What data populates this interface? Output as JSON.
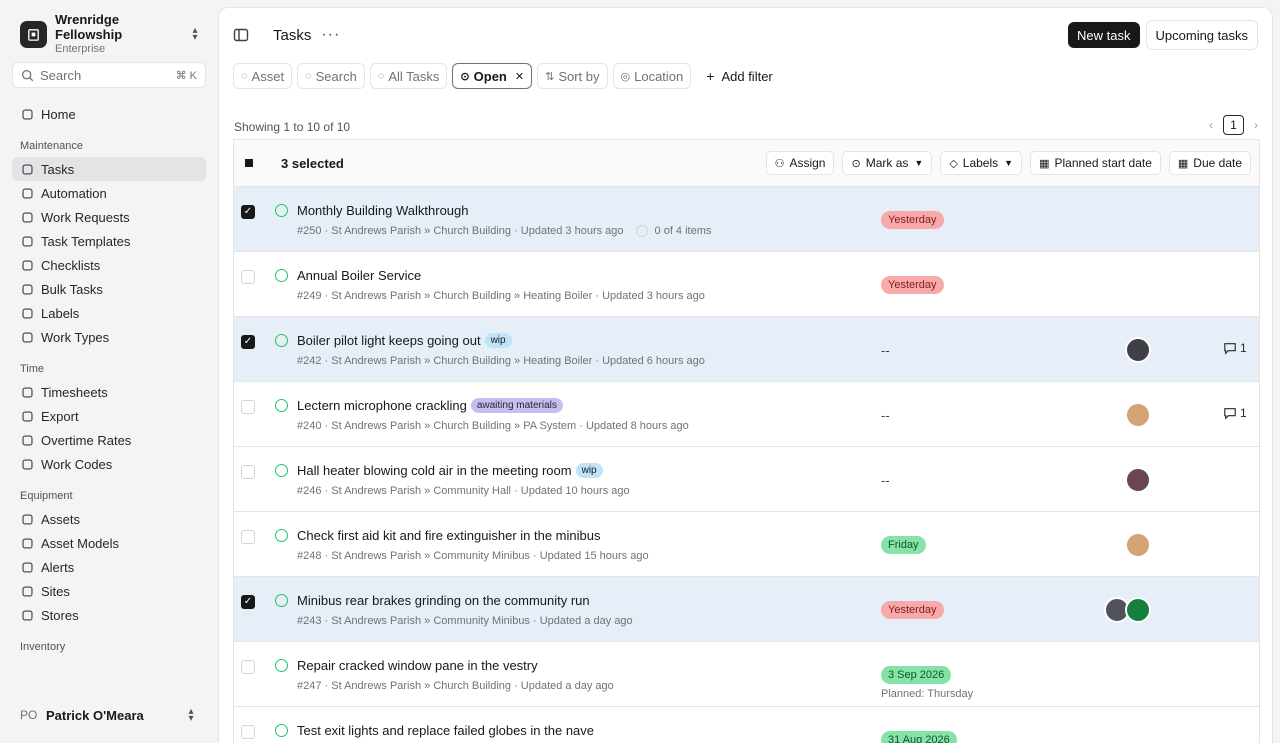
{
  "sidebar": {
    "org_name": "Wrenridge Fellowship",
    "org_plan": "Enterprise",
    "search_label": "Search",
    "search_kbd": "⌘ K",
    "top_items": [
      {
        "label": "Home",
        "icon": "home-icon"
      }
    ],
    "sections": [
      {
        "title": "Maintenance",
        "items": [
          {
            "label": "Tasks",
            "icon": "tasks-icon",
            "active": true
          },
          {
            "label": "Automation",
            "icon": "automation-icon"
          },
          {
            "label": "Work Requests",
            "icon": "work-requests-icon"
          },
          {
            "label": "Task Templates",
            "icon": "task-templates-icon"
          },
          {
            "label": "Checklists",
            "icon": "checklists-icon"
          },
          {
            "label": "Bulk Tasks",
            "icon": "bulk-tasks-icon"
          },
          {
            "label": "Labels",
            "icon": "labels-icon"
          },
          {
            "label": "Work Types",
            "icon": "work-types-icon"
          }
        ]
      },
      {
        "title": "Time",
        "items": [
          {
            "label": "Timesheets",
            "icon": "timesheets-icon"
          },
          {
            "label": "Export",
            "icon": "export-icon"
          },
          {
            "label": "Overtime Rates",
            "icon": "overtime-rates-icon"
          },
          {
            "label": "Work Codes",
            "icon": "work-codes-icon"
          }
        ]
      },
      {
        "title": "Equipment",
        "items": [
          {
            "label": "Assets",
            "icon": "assets-icon"
          },
          {
            "label": "Asset Models",
            "icon": "asset-models-icon"
          },
          {
            "label": "Alerts",
            "icon": "alerts-icon"
          },
          {
            "label": "Sites",
            "icon": "sites-icon"
          },
          {
            "label": "Stores",
            "icon": "stores-icon"
          }
        ]
      },
      {
        "title": "Inventory",
        "items": []
      }
    ],
    "user_initials": "PO",
    "user_name": "Patrick O'Meara"
  },
  "header": {
    "title": "Tasks",
    "new_task": "New task",
    "upcoming": "Upcoming tasks"
  },
  "filters": {
    "chips": [
      {
        "label": "Asset",
        "icon": "asset-icon"
      },
      {
        "label": "Search",
        "icon": "search-icon"
      },
      {
        "label": "All Tasks",
        "icon": "eye-icon"
      },
      {
        "label": "Open",
        "icon": "open-icon",
        "active": true
      },
      {
        "label": "Sort by",
        "icon": "sort-icon"
      },
      {
        "label": "Location",
        "icon": "location-icon"
      }
    ],
    "add_filter": "Add filter"
  },
  "list": {
    "showing": "Showing 1 to 10 of 10",
    "page": "1",
    "selected": "3 selected",
    "actions": [
      {
        "label": "Assign",
        "icon": "assign-icon"
      },
      {
        "label": "Mark as",
        "icon": "mark-icon",
        "dropdown": true
      },
      {
        "label": "Labels",
        "icon": "labels-icon",
        "dropdown": true
      },
      {
        "label": "Planned start date",
        "icon": "calendar-icon"
      },
      {
        "label": "Due date",
        "icon": "calendar-icon"
      }
    ]
  },
  "tasks": [
    {
      "title": "Monthly Building Walkthrough",
      "meta": "#250 · St Andrews Parish » Church Building · Updated 3 hours ago",
      "checklist": "0 of 4 items",
      "checked": true,
      "due": "Yesterday",
      "due_color": "red",
      "avatars": [],
      "comments": ""
    },
    {
      "title": "Annual Boiler Service",
      "meta": "#249 · St Andrews Parish » Church Building » Heating Boiler · Updated 3 hours ago",
      "checked": false,
      "due": "Yesterday",
      "due_color": "red",
      "avatars": [],
      "comments": ""
    },
    {
      "title": "Boiler pilot light keeps going out",
      "tag": "wip",
      "tag_kind": "wip",
      "meta": "#242 · St Andrews Parish » Church Building » Heating Boiler · Updated 6 hours ago",
      "checked": true,
      "due": "--",
      "avatars": [
        "#3f3f46"
      ],
      "comments": "1"
    },
    {
      "title": "Lectern microphone crackling",
      "tag": "awaiting materials",
      "tag_kind": "awt",
      "meta": "#240 · St Andrews Parish » Church Building » PA System · Updated 8 hours ago",
      "checked": false,
      "due": "--",
      "avatars": [
        "#d4a373"
      ],
      "comments": "1"
    },
    {
      "title": "Hall heater blowing cold air in the meeting room",
      "tag": "wip",
      "tag_kind": "wip",
      "meta": "#246 · St Andrews Parish » Community Hall · Updated 10 hours ago",
      "checked": false,
      "due": "--",
      "avatars": [
        "#6b4456"
      ],
      "comments": ""
    },
    {
      "title": "Check first aid kit and fire extinguisher in the minibus",
      "meta": "#248 · St Andrews Parish » Community Minibus · Updated 15 hours ago",
      "checked": false,
      "due": "Friday",
      "due_color": "green",
      "avatars": [
        "#d4a373"
      ],
      "comments": ""
    },
    {
      "title": "Minibus rear brakes grinding on the community run",
      "meta": "#243 · St Andrews Parish » Community Minibus · Updated a day ago",
      "checked": true,
      "due": "Yesterday",
      "due_color": "red",
      "avatars": [
        "#52525b",
        "#15803d"
      ],
      "comments": ""
    },
    {
      "title": "Repair cracked window pane in the vestry",
      "meta": "#247 · St Andrews Parish » Church Building · Updated a day ago",
      "checked": false,
      "due": "3 Sep 2026",
      "due_color": "green",
      "planned": "Planned: Thursday",
      "avatars": [],
      "comments": ""
    },
    {
      "title": "Test exit lights and replace failed globes in the nave",
      "meta": "",
      "checked": false,
      "due": "31 Aug 2026",
      "due_color": "green",
      "avatars": [],
      "comments": ""
    }
  ]
}
